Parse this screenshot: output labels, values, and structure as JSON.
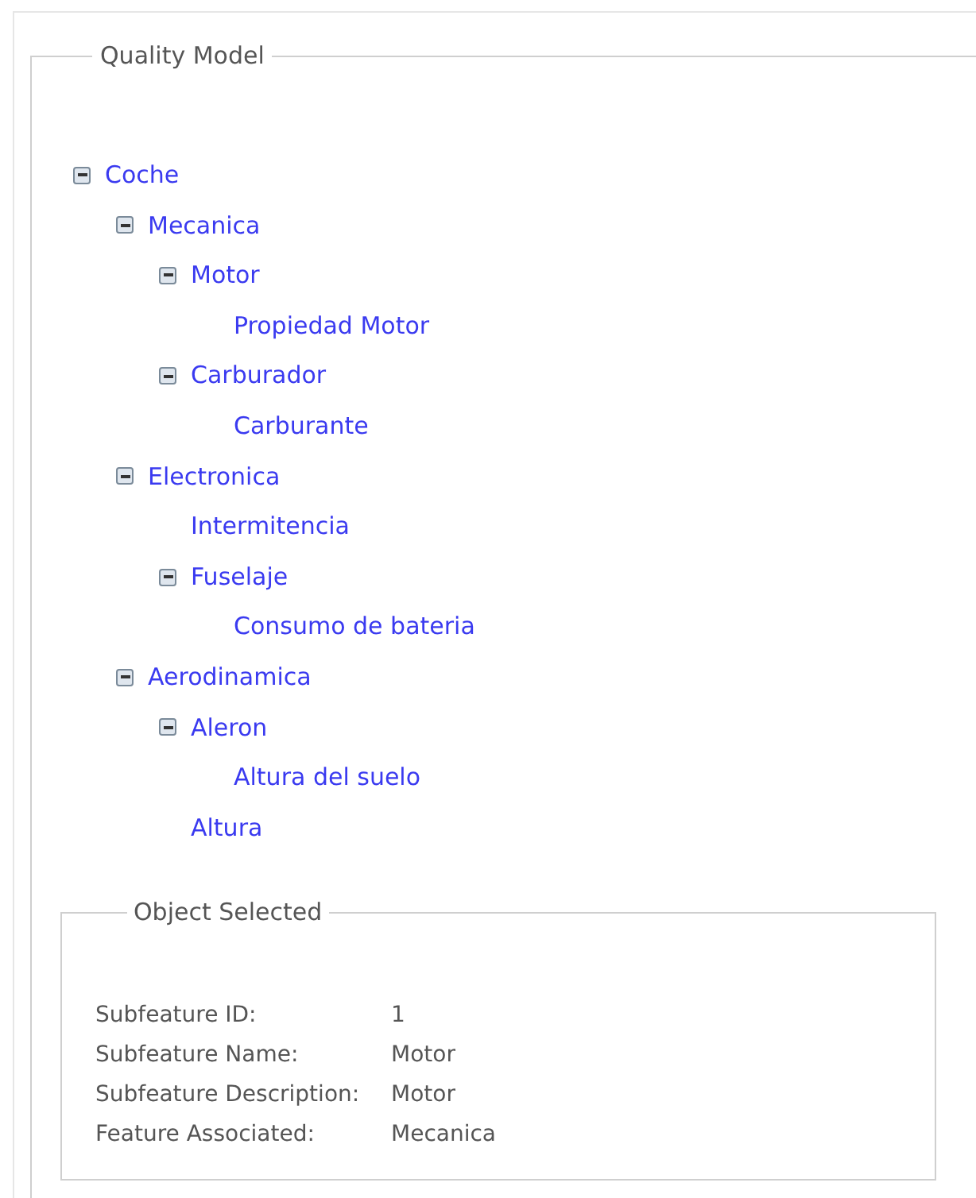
{
  "quality_model": {
    "title": "Quality Model",
    "tree": [
      {
        "label": "Coche",
        "expanded": true,
        "children": [
          {
            "label": "Mecanica",
            "expanded": true,
            "children": [
              {
                "label": "Motor",
                "expanded": true,
                "children": [
                  {
                    "label": "Propiedad Motor"
                  }
                ]
              },
              {
                "label": "Carburador",
                "expanded": true,
                "children": [
                  {
                    "label": "Carburante"
                  }
                ]
              }
            ]
          },
          {
            "label": "Electronica",
            "expanded": true,
            "children": [
              {
                "label": "Intermitencia"
              },
              {
                "label": "Fuselaje",
                "expanded": true,
                "children": [
                  {
                    "label": "Consumo de bateria"
                  }
                ]
              }
            ]
          },
          {
            "label": "Aerodinamica",
            "expanded": true,
            "children": [
              {
                "label": "Aleron",
                "expanded": true,
                "children": [
                  {
                    "label": "Altura del suelo"
                  }
                ]
              },
              {
                "label": "Altura"
              }
            ]
          }
        ]
      }
    ]
  },
  "object_selected": {
    "title": "Object Selected",
    "fields": [
      {
        "label": "Subfeature ID:",
        "value": "1"
      },
      {
        "label": "Subfeature Name:",
        "value": "Motor"
      },
      {
        "label": "Subfeature Description:",
        "value": "Motor"
      },
      {
        "label": "Feature Associated:",
        "value": "Mecanica"
      }
    ]
  }
}
